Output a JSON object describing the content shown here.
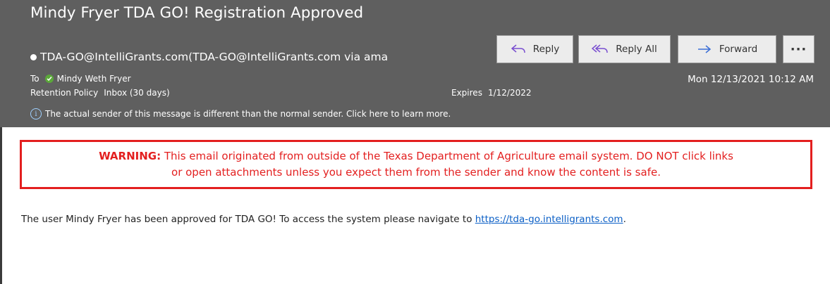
{
  "email": {
    "subject": "Mindy Fryer TDA GO! Registration Approved",
    "sender": "TDA-GO@IntelliGrants.com(TDA-GO@IntelliGrants.com via ama",
    "to_label": "To",
    "to_name": "Mindy Weth Fryer",
    "datetime": "Mon 12/13/2021 10:12 AM",
    "retention_label": "Retention Policy",
    "retention_value": "Inbox (30 days)",
    "expires_label": "Expires",
    "expires_value": "1/12/2022",
    "sender_notice": "The actual sender of this message is different than the normal sender. Click here to learn more."
  },
  "actions": {
    "reply": "Reply",
    "reply_all": "Reply All",
    "forward": "Forward",
    "more": "···"
  },
  "warning": {
    "prefix": "WARNING:",
    "line1": " This email originated from outside of the Texas Department of Agriculture email system. DO NOT click links",
    "line2": "or open attachments unless you expect them from the sender and know the content is safe."
  },
  "body": {
    "text": "The user Mindy Fryer has been approved for TDA GO! To access the system please navigate to ",
    "link": "https://tda-go.intelligrants.com",
    "suffix": "."
  },
  "colors": {
    "header_bg": "#5f5f5f",
    "warning": "#e31f1f",
    "link": "#0b5fc6",
    "button_bg": "#ececec"
  },
  "icons": [
    "reply-icon",
    "reply-all-icon",
    "forward-icon",
    "info-icon",
    "check-icon"
  ]
}
